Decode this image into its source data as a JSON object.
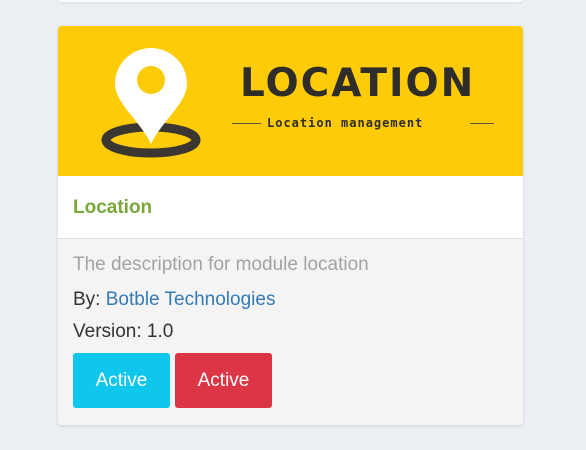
{
  "banner": {
    "title": "LOCATION",
    "subtitle": "Location management"
  },
  "module": {
    "title": "Location",
    "description": "The description for module location",
    "author_prefix": "By:",
    "author_name": "Botble Technologies",
    "version_label": "Version: 1.0"
  },
  "actions": {
    "activate_label": "Active",
    "deactivate_label": "Active"
  },
  "colors": {
    "banner_bg": "#fdcb08",
    "title": "#7aa63a",
    "link": "#337ab7",
    "activate_btn": "#0fc6ec",
    "deactivate_btn": "#dc3545"
  },
  "icons": {
    "banner_icon": "location-pin-icon"
  }
}
